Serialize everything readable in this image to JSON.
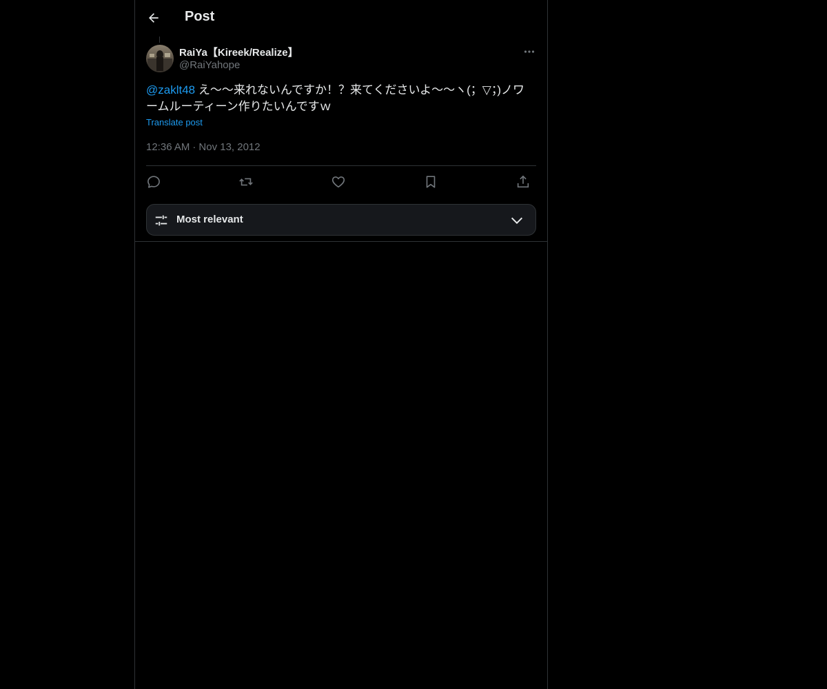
{
  "header": {
    "title": "Post",
    "back_icon": "arrow-left-icon"
  },
  "post": {
    "author": {
      "display_name": "RaiYa【Kireek/Realize】",
      "handle": "@RaiYahope"
    },
    "mention": "@zaklt48",
    "text": " え〜〜来れないんですか！？来てくださいよ〜〜ヽ(；▽；)ノワームルーティーン作りたいんですｗ",
    "translate_label": "Translate post",
    "time": "12:36 AM",
    "separator": "·",
    "date": "Nov 13, 2012",
    "more_icon": "more-horizontal-icon"
  },
  "actions": {
    "reply_icon": "reply-icon",
    "repost_icon": "repost-icon",
    "like_icon": "heart-icon",
    "bookmark_icon": "bookmark-icon",
    "share_icon": "share-icon"
  },
  "sort": {
    "label": "Most relevant",
    "icon": "sliders-icon",
    "chevron": "chevron-down-icon"
  },
  "colors": {
    "background": "#000000",
    "text": "#e7e9ea",
    "secondary": "#71767b",
    "accent": "#1d9bf0",
    "border": "#2f3336",
    "sort_background": "#16181c"
  }
}
